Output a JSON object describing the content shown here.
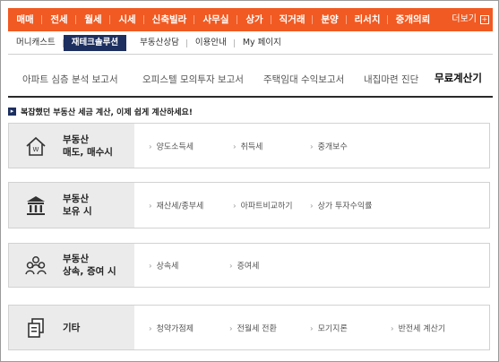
{
  "top_nav": {
    "items": [
      "매매",
      "전세",
      "월세",
      "시세",
      "신축빌라",
      "사무실",
      "상가",
      "직거래",
      "분양",
      "리서치",
      "중개의뢰"
    ],
    "more_label": "더보기",
    "accent_color": "#f15a22"
  },
  "sub_nav": {
    "items": [
      "머니캐스트",
      "재테크솔루션",
      "부동산상담",
      "이용안내",
      "My 페이지"
    ],
    "active_index": 1
  },
  "tabs": {
    "items": [
      "아파트 심층 분석 보고서",
      "오피스텔 모의투자 보고서",
      "주택임대 수익보고서",
      "내집마련 진단",
      "무료계산기"
    ],
    "active_index": 4
  },
  "notice": {
    "text": "복잡했던 부동산 세금 계산, 이제 쉽게 계산하세요!"
  },
  "cards": [
    {
      "title_line1": "부동산",
      "title_line2": "매도, 매수시",
      "icon": "house-won-icon",
      "links": [
        "양도소득세",
        "취득세",
        "중개보수"
      ]
    },
    {
      "title_line1": "부동산",
      "title_line2": "보유 시",
      "icon": "bank-building-icon",
      "links": [
        "재산세/종부세",
        "아파트비교하기",
        "상가 투자수익률"
      ]
    },
    {
      "title_line1": "부동산",
      "title_line2": "상속, 증여 시",
      "icon": "people-group-icon",
      "links": [
        "상속세",
        "증여세"
      ]
    },
    {
      "title_line1": "기타",
      "title_line2": "",
      "icon": "documents-icon",
      "links": [
        "청약가점제",
        "전월세 전환",
        "모기지론",
        "반전세 계산기"
      ]
    }
  ]
}
